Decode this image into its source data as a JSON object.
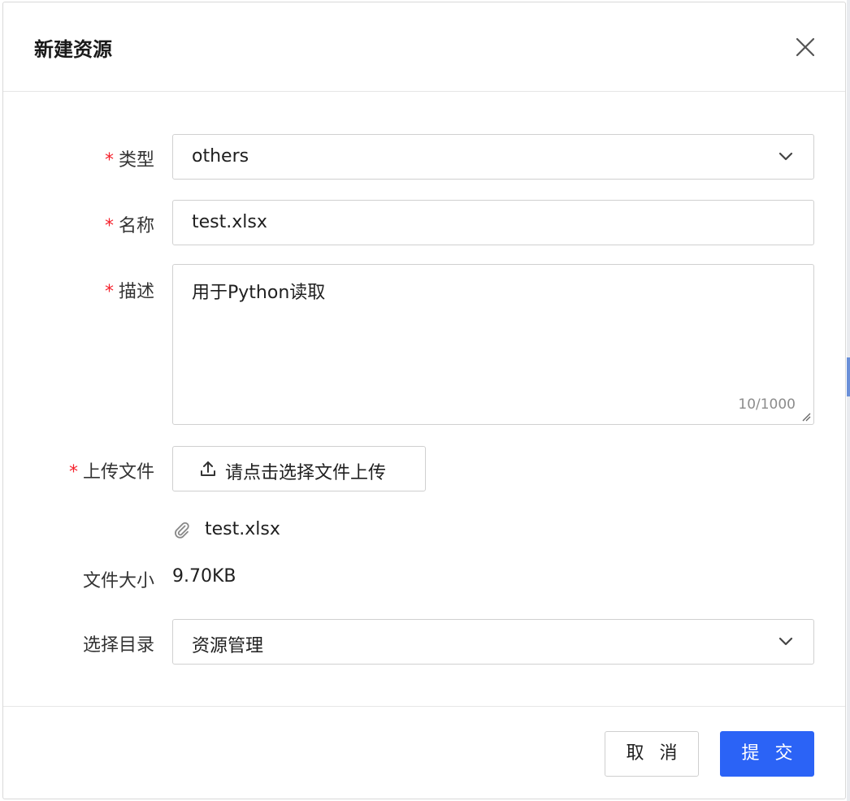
{
  "dialog": {
    "title": "新建资源"
  },
  "form": {
    "type": {
      "label": "类型",
      "required": true,
      "value": "others"
    },
    "name": {
      "label": "名称",
      "required": true,
      "value": "test.xlsx"
    },
    "description": {
      "label": "描述",
      "required": true,
      "value": "用于Python读取",
      "counter": "10/1000"
    },
    "upload": {
      "label": "上传文件",
      "required": true,
      "button_label": "请点击选择文件上传",
      "file_name": "test.xlsx"
    },
    "file_size": {
      "label": "文件大小",
      "value": "9.70KB"
    },
    "directory": {
      "label": "选择目录",
      "value": "资源管理"
    }
  },
  "footer": {
    "cancel_label": "取 消",
    "submit_label": "提 交"
  },
  "icons": {
    "close": "close-icon",
    "select_arrow": "chevron-down-icon",
    "upload": "upload-icon",
    "attachment": "paperclip-icon"
  },
  "colors": {
    "primary": "#2b63f6",
    "required": "#f5222d",
    "border": "#d0d0d0"
  }
}
